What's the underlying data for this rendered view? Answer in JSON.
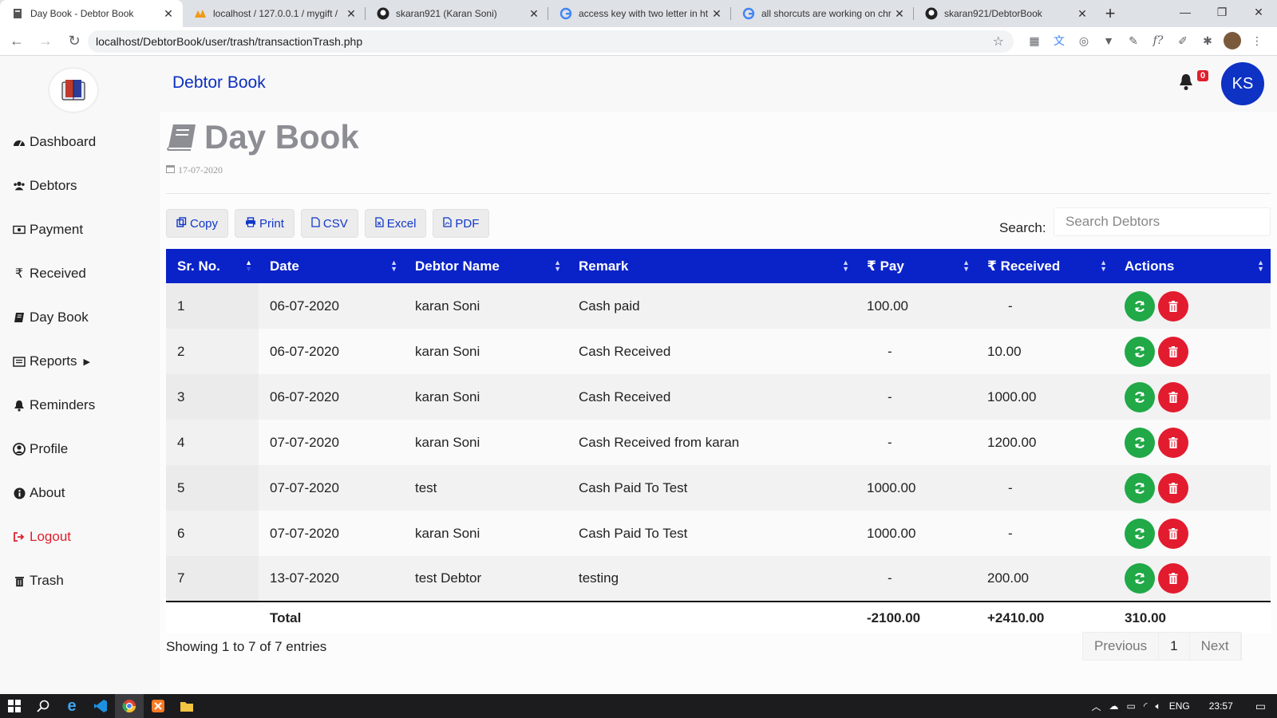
{
  "browser": {
    "tabs": [
      {
        "title": "Day Book - Debtor Book",
        "active": true
      },
      {
        "title": "localhost / 127.0.0.1 / mygift / ",
        "active": false
      },
      {
        "title": "skaran921 (Karan Soni)",
        "active": false
      },
      {
        "title": "access key with two letter in ht",
        "active": false
      },
      {
        "title": "all shorcuts are working on chr",
        "active": false
      },
      {
        "title": "skaran921/DebtorBook",
        "active": false
      }
    ],
    "url": "localhost/DebtorBook/user/trash/transactionTrash.php"
  },
  "app": {
    "brand": "Debtor Book",
    "notification_count": "0",
    "user_initials": "KS"
  },
  "sidebar": {
    "items": [
      {
        "label": "Dashboard",
        "icon": "dashboard-icon"
      },
      {
        "label": "Debtors",
        "icon": "users-icon"
      },
      {
        "label": "Payment",
        "icon": "money-icon"
      },
      {
        "label": "Received",
        "icon": "rupee-icon"
      },
      {
        "label": "Day Book",
        "icon": "book-icon"
      },
      {
        "label": "Reports",
        "icon": "list-icon"
      },
      {
        "label": "Reminders",
        "icon": "bell-icon"
      },
      {
        "label": "Profile",
        "icon": "user-circle-icon"
      },
      {
        "label": "About",
        "icon": "info-icon"
      },
      {
        "label": "Logout",
        "icon": "sign-out-icon"
      },
      {
        "label": "Trash",
        "icon": "trash-icon"
      }
    ]
  },
  "page": {
    "title": "Day Book",
    "date": "17-07-2020"
  },
  "toolbar": {
    "copy": "Copy",
    "print": "Print",
    "csv": "CSV",
    "excel": "Excel",
    "pdf": "PDF",
    "search_label": "Search:",
    "search_placeholder": "Search Debtors"
  },
  "table": {
    "headers": [
      "Sr. No.",
      "Date",
      "Debtor Name",
      "Remark",
      "Pay",
      "Received",
      "Actions"
    ],
    "rows": [
      {
        "sr": "1",
        "date": "06-07-2020",
        "name": "karan Soni",
        "remark": "Cash paid",
        "pay": "100.00",
        "received": "-"
      },
      {
        "sr": "2",
        "date": "06-07-2020",
        "name": "karan Soni",
        "remark": "Cash Received",
        "pay": "-",
        "received": "10.00"
      },
      {
        "sr": "3",
        "date": "06-07-2020",
        "name": "karan Soni",
        "remark": "Cash Received",
        "pay": "-",
        "received": "1000.00"
      },
      {
        "sr": "4",
        "date": "07-07-2020",
        "name": "karan Soni",
        "remark": "Cash Received from karan",
        "pay": "-",
        "received": "1200.00"
      },
      {
        "sr": "5",
        "date": "07-07-2020",
        "name": "test",
        "remark": "Cash Paid To Test",
        "pay": "1000.00",
        "received": "-"
      },
      {
        "sr": "6",
        "date": "07-07-2020",
        "name": "karan Soni",
        "remark": "Cash Paid To Test",
        "pay": "1000.00",
        "received": "-"
      },
      {
        "sr": "7",
        "date": "13-07-2020",
        "name": "test Debtor",
        "remark": "testing",
        "pay": "-",
        "received": "200.00"
      }
    ],
    "footer": {
      "label": "Total",
      "pay": "-2100.00",
      "received": "+2410.00",
      "balance": "310.00"
    }
  },
  "pagination": {
    "info": "Showing 1 to 7 of 7 entries",
    "previous": "Previous",
    "page": "1",
    "next": "Next"
  },
  "taskbar": {
    "lang": "ENG",
    "time": "23:57"
  },
  "colors": {
    "primary": "#0a23c8",
    "restore": "#21a847",
    "delete": "#e31b2e",
    "logout": "#e0202e"
  }
}
